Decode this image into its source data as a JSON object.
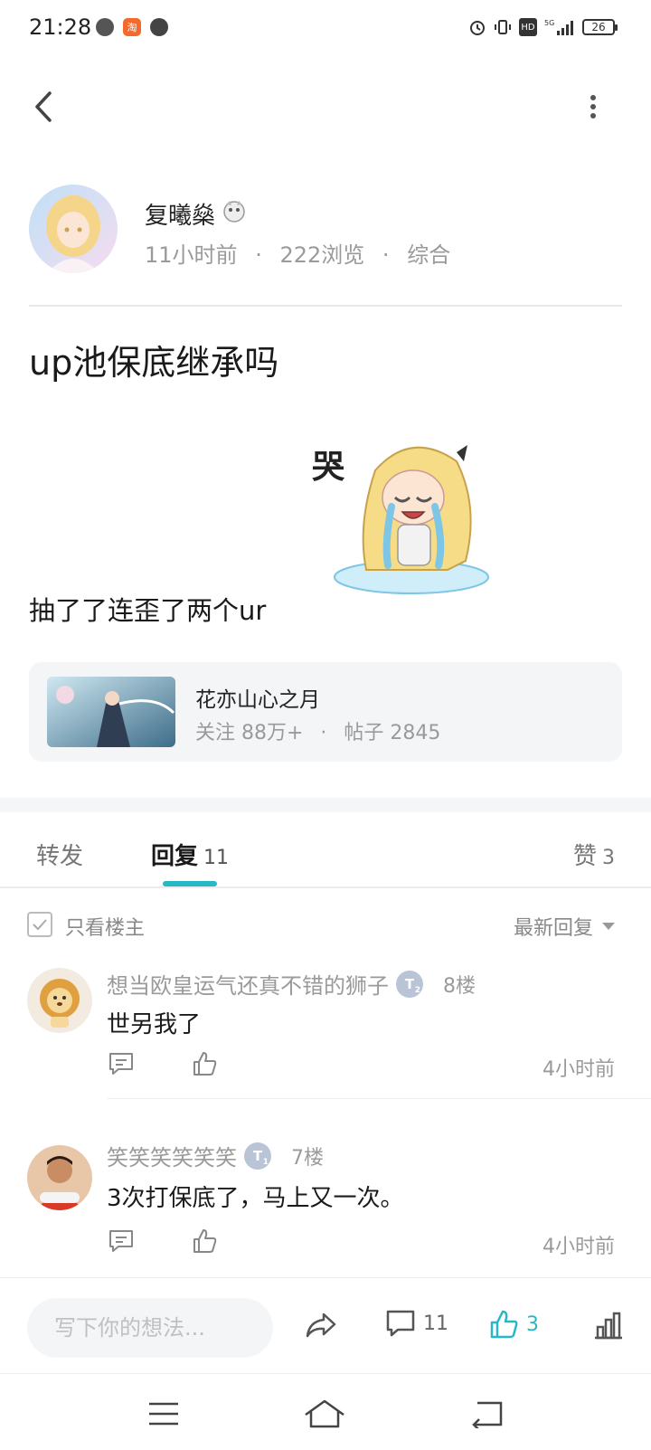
{
  "status_bar": {
    "time": "21:28",
    "battery": "26",
    "network": "5G",
    "hd": "HD"
  },
  "icons": {
    "back": "chevron-left-icon",
    "more": "more-vertical-icon",
    "share": "share-arrow-icon",
    "comment": "comment-bubble-icon",
    "like": "thumbs-up-icon",
    "stats": "bar-chart-icon"
  },
  "post": {
    "author_name": "复曦燊",
    "time_ago": "11小时前",
    "views": "222浏览",
    "category": "综合",
    "separator": "·",
    "title": "up池保底继承吗",
    "body": "抽了了连歪了两个ur",
    "sticker_text": "哭"
  },
  "forum": {
    "name": "花亦山心之月",
    "followers": "关注 88万+",
    "posts": "帖子 2845"
  },
  "tabs": {
    "repost": "转发",
    "reply_label": "回复",
    "reply_count": "11",
    "like_label": "赞",
    "like_count": "3"
  },
  "filter": {
    "only_owner": "只看楼主",
    "sort": "最新回复"
  },
  "comments": [
    {
      "name": "想当欧皇运气还真不错的狮子",
      "level": "T",
      "level_sub": "2",
      "floor": "8楼",
      "text": "世另我了",
      "time": "4小时前"
    },
    {
      "name": "笑笑笑笑笑笑",
      "level": "T",
      "level_sub": "1",
      "floor": "7楼",
      "text": "3次打保底了，马上又一次。",
      "time": "4小时前"
    }
  ],
  "bottom_bar": {
    "placeholder": "写下你的想法...",
    "comment_count": "11",
    "like_count": "3"
  },
  "colors": {
    "accent": "#26b8c5",
    "text_primary": "#1a1a1a",
    "text_secondary": "#9a9a9a"
  }
}
